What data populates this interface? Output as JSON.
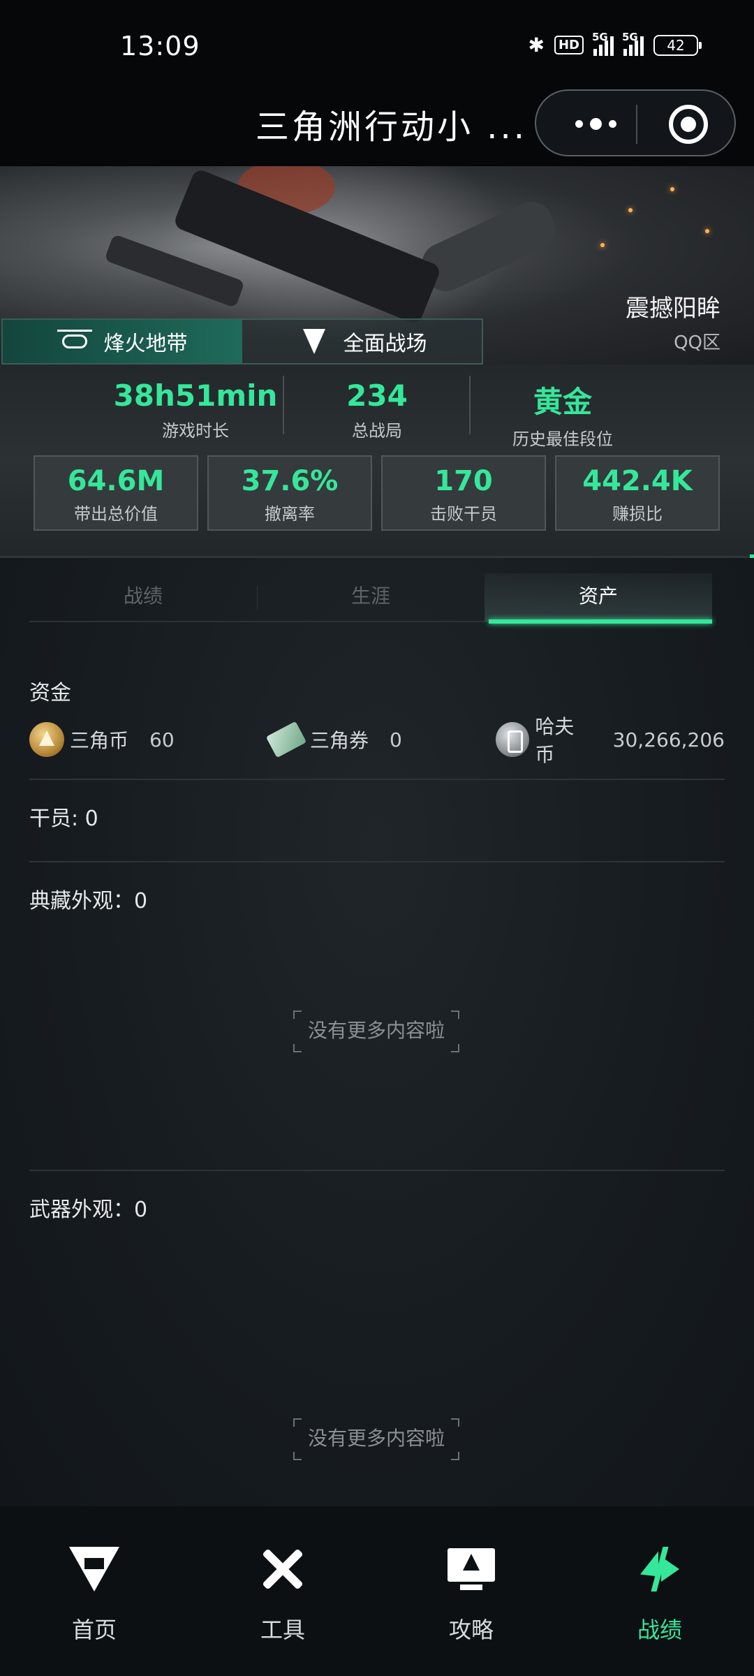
{
  "status_bar": {
    "time": "13:09",
    "hd_label": "HD",
    "network_1": "5G",
    "network_2": "5G",
    "battery": "42"
  },
  "title_bar": {
    "title": "三角洲行动小 ...",
    "more_icon": "more-dots-icon",
    "close_icon": "target-close-icon"
  },
  "banner": {
    "player_name": "震撼阳眸",
    "region": "QQ区"
  },
  "mode_tabs": [
    {
      "label": "烽火地带",
      "icon": "helicopter-icon",
      "active": true
    },
    {
      "label": "全面战场",
      "icon": "wing-emblem-icon",
      "active": false
    }
  ],
  "summary_stats": [
    {
      "value": "38h51min",
      "label": "游戏时长"
    },
    {
      "value": "234",
      "label": "总战局"
    },
    {
      "value": "黄金",
      "label": "历史最佳段位"
    }
  ],
  "detail_stats": [
    {
      "value": "64.6M",
      "label": "带出总价值"
    },
    {
      "value": "37.6%",
      "label": "撤离率"
    },
    {
      "value": "170",
      "label": "击败干员"
    },
    {
      "value": "442.4K",
      "label": "赚损比"
    }
  ],
  "sub_tabs": [
    {
      "label": "战绩",
      "active": false
    },
    {
      "label": "生涯",
      "active": false
    },
    {
      "label": "资产",
      "active": true
    }
  ],
  "assets": {
    "funds_title": "资金",
    "currencies": [
      {
        "name": "三角币",
        "value": "60",
        "icon": "delta-coin-icon"
      },
      {
        "name": "三角券",
        "value": "0",
        "icon": "delta-ticket-icon"
      },
      {
        "name": "哈夫币",
        "value": "30,266,206",
        "icon": "haf-coin-icon"
      }
    ],
    "operators": "干员: 0",
    "collection_skins": "典藏外观：0",
    "collection_empty": "没有更多内容啦",
    "weapon_skins": "武器外观：0",
    "weapon_empty": "没有更多内容啦"
  },
  "bottom_nav": [
    {
      "label": "首页",
      "icon": "home-logo-icon",
      "active": false
    },
    {
      "label": "工具",
      "icon": "tools-icon",
      "active": false
    },
    {
      "label": "攻略",
      "icon": "guide-monitor-icon",
      "active": false
    },
    {
      "label": "战绩",
      "icon": "records-icon",
      "active": true
    }
  ],
  "colors": {
    "accent": "#35e79a",
    "background": "#0b0f12"
  }
}
